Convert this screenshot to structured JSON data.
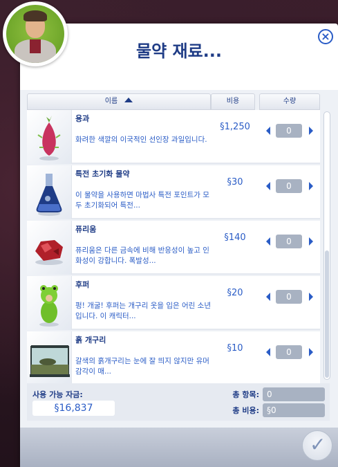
{
  "dialog": {
    "title": "물약 재료...",
    "close_icon": "close-icon",
    "confirm_icon": "checkmark-icon"
  },
  "columns": {
    "name": "이름",
    "cost": "비용",
    "quantity": "수량"
  },
  "items": [
    {
      "name": "용과",
      "desc": "화려한 색깔의 이국적인 선인장 과일입니다.",
      "price": "§1,250",
      "qty": "0",
      "icon": "dragonfruit-icon"
    },
    {
      "name": "특전 초기화 물약",
      "desc": "이 물약을 사용하면 마법사 특전 포인트가 모두 초기화되어 특전...",
      "price": "§30",
      "qty": "0",
      "icon": "potion-flask-icon"
    },
    {
      "name": "퓨리움",
      "desc": "퓨리움은 다른 금속에 비해 반응성이 높고 인화성이 강합니다. 폭발성...",
      "price": "§140",
      "qty": "0",
      "icon": "red-mineral-icon"
    },
    {
      "name": "후퍼",
      "desc": "펑! 개굴! 후퍼는 개구리 옷을 입은 어린 소년입니다. 이 캐릭터...",
      "price": "§20",
      "qty": "0",
      "icon": "frog-costume-toy-icon"
    },
    {
      "name": "흙 개구리",
      "desc": "갈색의 흙개구리는 눈에 잘 띄지 않지만 유머 감각이 매...",
      "price": "§10",
      "qty": "0",
      "icon": "frog-terrarium-icon"
    }
  ],
  "footer": {
    "funds_label": "사용 가능 자금:",
    "funds_value": "§16,837",
    "total_items_label": "총 항목:",
    "total_items_value": "0",
    "total_cost_label": "총 비용:",
    "total_cost_value": "§0"
  },
  "colors": {
    "accent": "#2a5cc6",
    "title": "#1f3c86"
  }
}
